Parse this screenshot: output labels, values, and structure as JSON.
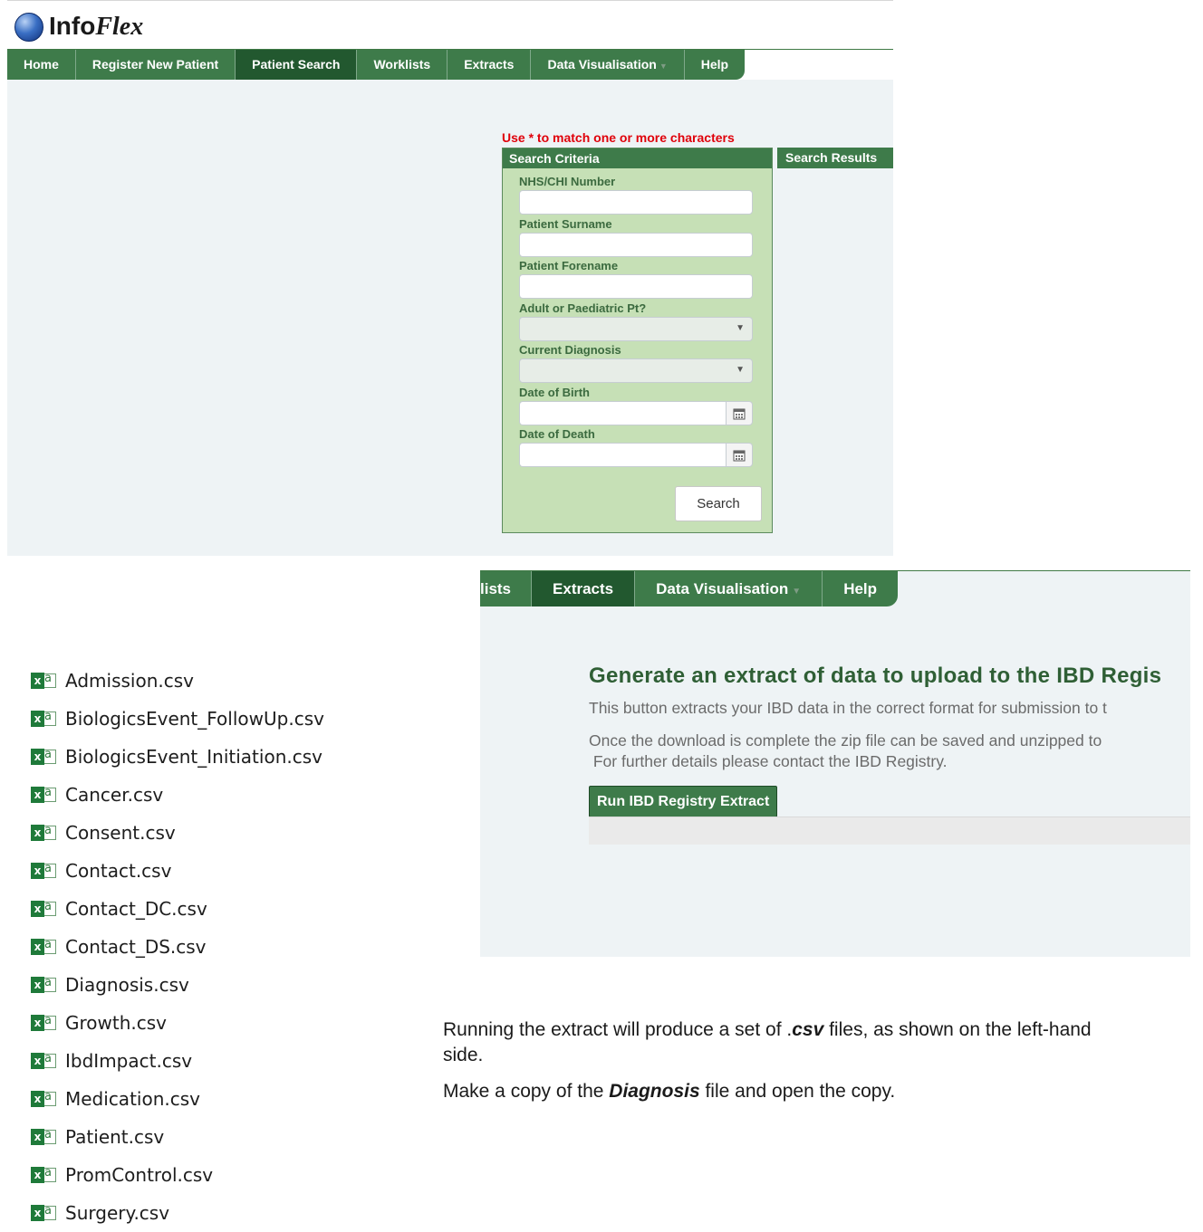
{
  "app": {
    "logo_text_plain": "Info",
    "logo_text_italic": "Flex"
  },
  "search_screen": {
    "nav": [
      {
        "label": "Home",
        "active": false
      },
      {
        "label": "Register New Patient",
        "active": false
      },
      {
        "label": "Patient Search",
        "active": true
      },
      {
        "label": "Worklists",
        "active": false
      },
      {
        "label": "Extracts",
        "active": false
      },
      {
        "label": "Data Visualisation",
        "active": false,
        "dropdown": true
      },
      {
        "label": "Help",
        "active": false
      }
    ],
    "hint": "Use * to match one or more characters",
    "criteria_title": "Search Criteria",
    "results_title": "Search Results",
    "fields": {
      "nhs": {
        "label": "NHS/CHI Number",
        "value": ""
      },
      "surname": {
        "label": "Patient Surname",
        "value": ""
      },
      "forename": {
        "label": "Patient Forename",
        "value": ""
      },
      "adult_paed": {
        "label": "Adult or Paediatric Pt?",
        "value": ""
      },
      "diagnosis": {
        "label": "Current Diagnosis",
        "value": ""
      },
      "dob": {
        "label": "Date of Birth",
        "value": ""
      },
      "dod": {
        "label": "Date of Death",
        "value": ""
      }
    },
    "search_button": "Search"
  },
  "extract_screen": {
    "nav": [
      {
        "label": "lists",
        "active": false
      },
      {
        "label": "Extracts",
        "active": true
      },
      {
        "label": "Data Visualisation",
        "active": false,
        "dropdown": true
      },
      {
        "label": "Help",
        "active": false
      }
    ],
    "heading": "Generate an extract of data to upload to the IBD Regis",
    "line1": "This button extracts your IBD data in the correct format for submission to t",
    "line2": "Once the download is complete the zip file can be saved and unzipped to",
    "line3": " For further details please contact the IBD Registry.",
    "run_button": "Run IBD Registry Extract"
  },
  "files": [
    "Admission.csv",
    "BiologicsEvent_FollowUp.csv",
    "BiologicsEvent_Initiation.csv",
    "Cancer.csv",
    "Consent.csv",
    "Contact.csv",
    "Contact_DC.csv",
    "Contact_DS.csv",
    "Diagnosis.csv",
    "Growth.csv",
    "IbdImpact.csv",
    "Medication.csv",
    "Patient.csv",
    "PromControl.csv",
    "Surgery.csv"
  ],
  "instructions": {
    "p1_before": "Running the extract will produce a set of .",
    "p1_emph": "csv",
    "p1_after": " files, as shown on the left-hand side.",
    "p2_before": "Make a copy of the ",
    "p2_emph": "Diagnosis",
    "p2_after": " file and open the copy."
  },
  "colors": {
    "nav_green": "#3e7b4a",
    "nav_active": "#22582f",
    "panel_green": "#c6e0b6",
    "hint_red": "#e0000a",
    "background": "#eef3f5"
  },
  "icons": {
    "calendar": "calendar-icon",
    "dropdown": "chevron-down-icon",
    "excel": "excel-file-icon"
  }
}
